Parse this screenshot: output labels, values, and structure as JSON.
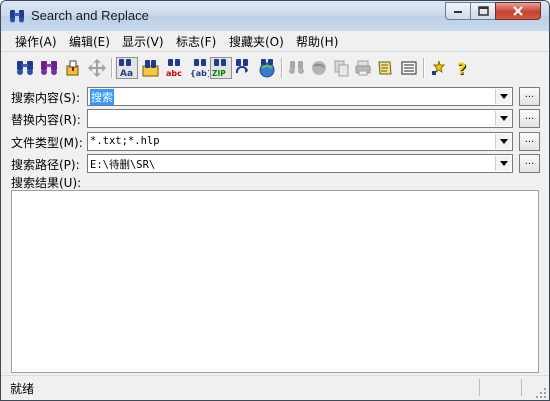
{
  "window": {
    "title": "Search and Replace",
    "controls": [
      "minimize",
      "maximize",
      "close"
    ]
  },
  "menu": [
    {
      "label": "操作(A)"
    },
    {
      "label": "编辑(E)"
    },
    {
      "label": "显示(V)"
    },
    {
      "label": "标志(F)"
    },
    {
      "label": "搜藏夹(O)"
    },
    {
      "label": "帮助(H)"
    }
  ],
  "toolbar": {
    "icons": [
      "search-icon",
      "search-replace-icon",
      "copy-to-icon",
      "move-icon",
      "match-case-icon",
      "folder-search-icon",
      "abc-replace-icon",
      "ab-bracket-icon",
      "zip-search-icon",
      "refresh-search-icon",
      "web-search-icon",
      "find-next-icon",
      "globe-icon",
      "paste-icon",
      "print-icon",
      "script-icon",
      "list-icon",
      "tips-icon",
      "help-icon"
    ]
  },
  "form": {
    "search": {
      "label": "搜索内容(S):",
      "value": "搜索"
    },
    "replace": {
      "label": "替换内容(R):",
      "value": ""
    },
    "filetype": {
      "label": "文件类型(M):",
      "value": "*.txt;*.hlp"
    },
    "path": {
      "label": "搜索路径(P):",
      "value": "E:\\待删\\SR\\"
    },
    "results_label": "搜索结果(U):",
    "browse_label": "..."
  },
  "status": {
    "text": "就绪"
  },
  "colors": {
    "selection": "#3399ff",
    "title_gradient": "#c8d8ea",
    "close_button": "#c64230"
  }
}
